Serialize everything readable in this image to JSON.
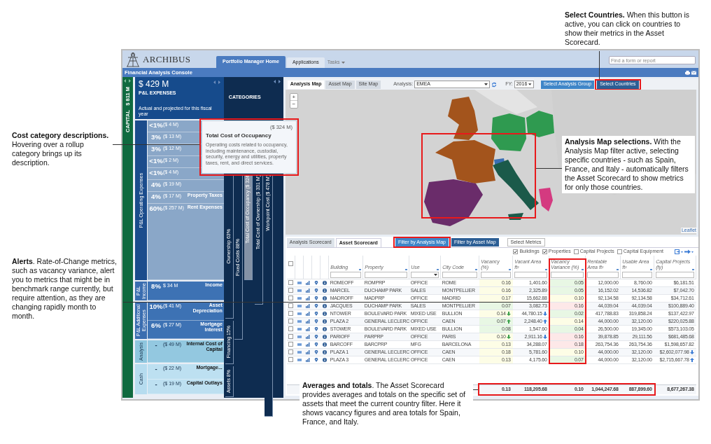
{
  "header": {
    "logo": "ARCHIBUS",
    "tabs": [
      {
        "label": "Portfolio Manager Home",
        "selected": true
      },
      {
        "label": "Applications",
        "selected": false
      },
      {
        "label": "Tasks",
        "selected": false
      }
    ],
    "search": {
      "placeholder": "Find a form or report"
    }
  },
  "title_bar": {
    "title": "Financial Analysis Console"
  },
  "capital": {
    "label": "CAPITAL",
    "value": "$ 811 M"
  },
  "pl": {
    "total": "$ 429 M",
    "title": "P&L EXPENSES",
    "subtitle": "Actual and projected for this fiscal year",
    "groups": [
      {
        "kind": "operating",
        "label": "P&L Operating Expenses",
        "rows": [
          {
            "percent": "<1%",
            "amount": "($ 4 M)"
          },
          {
            "percent": "3%",
            "amount": "($ 13 M)"
          },
          {
            "percent": "3%",
            "amount": "($ 12 M)"
          },
          {
            "percent": "<1%",
            "amount": "($ 2 M)"
          },
          {
            "percent": "<1%",
            "amount": "($ 4 M)"
          },
          {
            "percent": "4%",
            "amount": "($ 19 M)"
          },
          {
            "percent": "4%",
            "amount": "($ 17 M)",
            "label": "Property Taxes"
          },
          {
            "percent": "60%",
            "amount": "($ 257 M)",
            "label": "Rent Expenses"
          }
        ]
      },
      {
        "kind": "income",
        "label": "P&L Income",
        "rows": [
          {
            "percent": "8%",
            "amount": "$ 34 M",
            "label": "Income"
          }
        ]
      },
      {
        "kind": "additional",
        "label": "P&L Additional Expenses",
        "rows": [
          {
            "percent": "10%",
            "amount": "($ 41 M)",
            "label": "Asset Depreciation"
          },
          {
            "percent": "6%",
            "amount": "($ 27 M)",
            "label": "Mortgage Interest"
          }
        ]
      },
      {
        "kind": "analysis",
        "label": "Analysis",
        "rows": [
          {
            "percent": "-",
            "amount": "($ 49 M)",
            "label": "Internal Cost of Capital"
          }
        ]
      },
      {
        "kind": "cash",
        "label": "Cash",
        "rows": [
          {
            "percent": "-",
            "amount": "($ 22 M)",
            "label": "Mortgage..."
          },
          {
            "percent": "-",
            "amount": "($ 19 M)",
            "label": "Capital Outlays"
          }
        ]
      }
    ]
  },
  "categories": {
    "title": "CATEGORIES",
    "bars": [
      {
        "label": "Ownership 63%",
        "selected": false
      },
      {
        "label": "Fixed Costs 88%",
        "selected": false
      },
      {
        "label": "Total Cost of Occupancy ($ 324",
        "selected": true
      },
      {
        "label": "Total Cost of Ownership ($ 331 M)",
        "selected": false
      },
      {
        "label": "Workpoint Cost ($ 478 M)",
        "selected": false
      },
      {
        "label": "Financing 15%",
        "selected": false
      },
      {
        "label": "Assets 8%",
        "selected": false
      }
    ]
  },
  "tooltip": {
    "amount": "($ 324 M)",
    "title": "Total Cost of Occupancy",
    "text": "Operating costs related to occupancy, including maintenance, custodial, security, energy and utilities, property taxes, rent, and direct services."
  },
  "map": {
    "tabs": [
      {
        "label": "Analysis Map",
        "selected": true
      },
      {
        "label": "Asset Map",
        "selected": false
      },
      {
        "label": "Site Map",
        "selected": false
      }
    ],
    "analysis_label": "Analysis:",
    "analysis_value": "EMEA",
    "fy_label": "FY:",
    "fy_value": "2016",
    "buttons": [
      {
        "label": "Select Analysis Group",
        "selected": false
      },
      {
        "label": "Select Countries",
        "selected": true
      }
    ],
    "zoom_in": "+",
    "zoom_out": "−",
    "attribution": "Leaflet"
  },
  "scorecard": {
    "tabs": [
      {
        "label": "Analysis Scorecard",
        "selected": false
      },
      {
        "label": "Asset Scorecard",
        "selected": true
      }
    ],
    "filters": [
      {
        "label": "Filter by Analysis Map",
        "selected": true
      },
      {
        "label": "Filter by Asset Map",
        "selected": false
      }
    ],
    "select_metrics": "Select Metrics",
    "types": [
      {
        "label": "Buildings",
        "checked": true
      },
      {
        "label": "Properties",
        "checked": true
      },
      {
        "label": "Capital Projects",
        "checked": false
      },
      {
        "label": "Capital Equipment",
        "checked": false
      }
    ],
    "columns": [
      "Building",
      "Property",
      "Use",
      "City Code",
      "Vacancy (%)",
      "Vacant Area ft²",
      "Vacancy Variance (%)",
      "Rentable Area ft²",
      "Usable Area ft²",
      "Capital Projects (fy)"
    ],
    "header_checkbox": {
      "checked": false
    },
    "rows": [
      {
        "checked": false,
        "building": "ROMEOFF",
        "property": "ROMPRP",
        "use": "OFFICE",
        "city": "ROME",
        "vacancy": {
          "value": "0.16",
          "color": "#fdfde6"
        },
        "vacant_area": "1,401.60",
        "variance": {
          "value": "0.05",
          "color": "#e8f7e4"
        },
        "rentable": "12,000.00",
        "usable": "8,760.00",
        "capital": "$6,181.51"
      },
      {
        "checked": false,
        "building": "MARCEL",
        "property": "DUCHAMP PARK",
        "use": "SALES",
        "city": "MONTPELLIER",
        "vacancy": {
          "value": "0.16",
          "color": "#fdfde6"
        },
        "vacant_area": "2,325.89",
        "variance": {
          "value": "0.05",
          "color": "#e8f7e4"
        },
        "rentable": "16,152.02",
        "usable": "14,536.82",
        "capital": "$7,042.70"
      },
      {
        "checked": false,
        "building": "MADROFF",
        "property": "MADPRP",
        "use": "OFFICE",
        "city": "MADRID",
        "vacancy": {
          "value": "0.17",
          "color": "#fdfde6"
        },
        "vacant_area": "15,662.88",
        "variance": {
          "value": "0.10",
          "color": "#fdfde6"
        },
        "rentable": "92,134.58",
        "usable": "92,134.58",
        "capital": "$34,712.61"
      },
      {
        "checked": false,
        "building": "JACQUES",
        "property": "DUCHAMP PARK",
        "use": "SALES",
        "city": "MONTPELLIER",
        "vacancy": {
          "value": "0.07",
          "color": "#e8f7e4"
        },
        "vacant_area": "3,082.73",
        "variance": {
          "value": "0.16",
          "color": "#fde8e8"
        },
        "rentable": "44,039.04",
        "usable": "44,039.04",
        "capital": "$100,889.40"
      },
      {
        "checked": false,
        "building": "NTOWER",
        "property": "BOULEVARD PARK",
        "use": "MIXED USE",
        "city": "BULLION",
        "vacancy": {
          "value": "0.14",
          "color": "#fdfde6",
          "kind": "falling"
        },
        "vacant_area": {
          "value": "44,780.15",
          "kind": "falling"
        },
        "variance": {
          "value": "0.02",
          "color": "#e8f7e4"
        },
        "rentable": "417,788.83",
        "usable": "319,858.24",
        "capital": "$137,422.97"
      },
      {
        "checked": false,
        "building": "PLAZA 2",
        "property": "GENERAL LECLERC",
        "use": "OFFICE",
        "city": "CAEN",
        "vacancy": {
          "value": "0.07",
          "color": "#e8f7e4",
          "kind": "rising"
        },
        "vacant_area": {
          "value": "2,248.40",
          "kind": "rising"
        },
        "variance": {
          "value": "0.14",
          "color": "#fdfde6"
        },
        "rentable": "44,000.00",
        "usable": "32,120.00",
        "capital": "$220,025.88"
      },
      {
        "checked": false,
        "building": "STOWER",
        "property": "BOULEVARD PARK",
        "use": "MIXED USE",
        "city": "BULLION",
        "vacancy": {
          "value": "0.08",
          "color": "#e8f7e4"
        },
        "vacant_area": "1,547.60",
        "variance": {
          "value": "0.04",
          "color": "#e8f7e4"
        },
        "rentable": "26,500.00",
        "usable": "19,345.00",
        "capital": "$573,103.05"
      },
      {
        "checked": false,
        "building": "PARIOFF",
        "property": "PARPRP",
        "use": "OFFICE",
        "city": "PARIS",
        "vacancy": {
          "value": "0.10",
          "color": "#fdfde6",
          "kind": "falling"
        },
        "vacant_area": {
          "value": "2,911.16",
          "kind": "falling"
        },
        "variance": {
          "value": "0.16",
          "color": "#fde8e8"
        },
        "rentable": "39,878.85",
        "usable": "29,111.56",
        "capital": "$681,485.68"
      },
      {
        "checked": false,
        "building": "BARCOFF",
        "property": "BARCPRP",
        "use": "MFG",
        "city": "BARCELONA",
        "vacancy": {
          "value": "0.13",
          "color": "#fdfde6"
        },
        "vacant_area": "34,288.07",
        "variance": {
          "value": "0.18",
          "color": "#fde8e8"
        },
        "rentable": "263,754.36",
        "usable": "263,754.36",
        "capital": "$1,598,657.82"
      },
      {
        "checked": false,
        "building": "PLAZA 1",
        "property": "GENERAL LECLERC",
        "use": "OFFICE",
        "city": "CAEN",
        "vacancy": {
          "value": "0.18",
          "color": "#fdfde6"
        },
        "vacant_area": "5,781.60",
        "variance": {
          "value": "0.10",
          "color": "#fdfde6"
        },
        "rentable": "44,000.00",
        "usable": "32,120.00",
        "capital": {
          "value": "$2,602,077.98",
          "kind": "falling"
        }
      },
      {
        "checked": false,
        "building": "PLAZA 3",
        "property": "GENERAL LECLERC",
        "use": "OFFICE",
        "city": "CAEN",
        "vacancy": {
          "value": "0.13",
          "color": "#fdfde6"
        },
        "vacant_area": "4,175.60",
        "variance": {
          "value": "0.07",
          "color": "#e8f7e4"
        },
        "rentable": "44,000.00",
        "usable": "32,120.00",
        "capital": {
          "value": "$2,715,667.78",
          "kind": "rising"
        }
      }
    ],
    "totals": {
      "vacancy": "0.13",
      "vacant_area": "118,205.68",
      "variance": "0.10",
      "rentable": "1,044,247.68",
      "usable": "887,899.60",
      "capital": "8,677,267.38"
    }
  },
  "callouts": [
    {
      "text": "**Select Countries.** When this button is active, you can click on countries to show their metrics in the Asset Scorecard."
    },
    {
      "text": "**Cost category descriptions.** Hovering over a rollup category brings up its description."
    },
    {
      "text": "**Alerts**. Rate-of-Change metrics, such as vacancy variance, alert you to metrics that might be in benchmark range currently, but require attention, as they are changing rapidly month to month."
    },
    {
      "text": "**Analysis Map selections.** With the Analysis Map filter active, selecting specific countries - such as Spain, France, and Italy - automatically filters the Asset Scorecard to show metrics for only those countries."
    },
    {
      "text": "**Averages and totals**. The Asset Scorecard provides averages and totals on the specific set of assets that meet the current country filter. Here it shows vacancy figures and area totals for Spain, France, and Italy."
    }
  ]
}
